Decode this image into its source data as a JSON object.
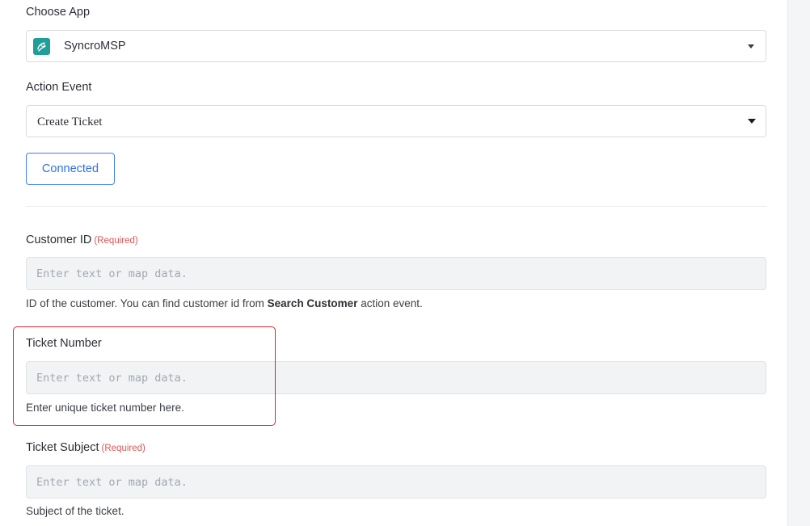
{
  "choose_app": {
    "label": "Choose App",
    "selected": "SyncroMSP",
    "icon": "syncromsp-logo-icon"
  },
  "action_event": {
    "label": "Action Event",
    "selected": "Create Ticket"
  },
  "connect_button": {
    "label": "Connected"
  },
  "fields": {
    "customer_id": {
      "label": "Customer ID",
      "required": "(Required)",
      "placeholder": "Enter text or map data.",
      "help_prefix": "ID of the customer. You can find customer id from ",
      "help_bold": "Search Customer",
      "help_suffix": " action event."
    },
    "ticket_number": {
      "label": "Ticket Number",
      "placeholder": "Enter text or map data.",
      "help": "Enter unique ticket number here."
    },
    "ticket_subject": {
      "label": "Ticket Subject",
      "required": "(Required)",
      "placeholder": "Enter text or map data.",
      "help": "Subject of the ticket."
    }
  },
  "colors": {
    "accent": "#2f6fed",
    "required": "#e05454",
    "highlight": "#e0262f",
    "app_icon_bg": "#1f9e9a"
  }
}
